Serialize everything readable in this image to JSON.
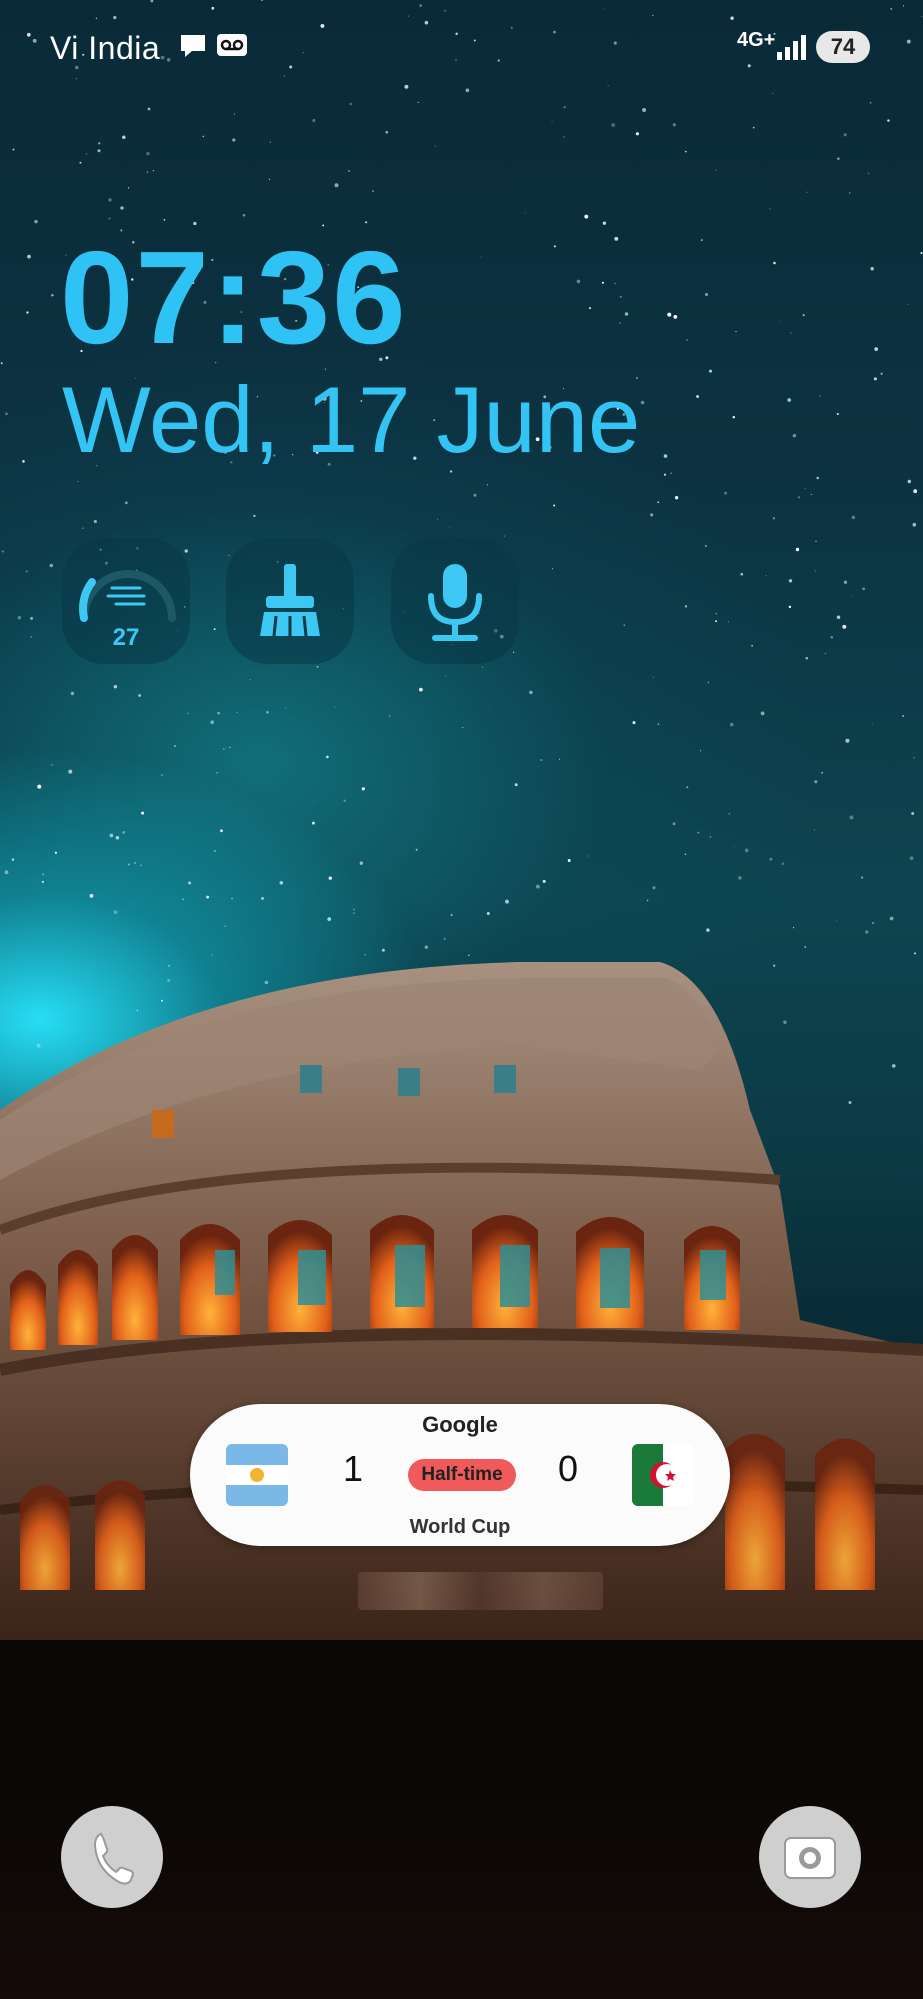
{
  "status_bar": {
    "carrier": "Vi India",
    "network": "4G+",
    "battery": "74"
  },
  "clock": {
    "time": "07:36",
    "date": "Wed, 17 June"
  },
  "widgets": {
    "weather_temp": "27"
  },
  "score_card": {
    "source": "Google",
    "home_score": "1",
    "away_score": "0",
    "status": "Half-time",
    "competition": "World Cup"
  },
  "icons": {
    "carrier_extra": [
      "chat-bubble-icon",
      "voicemail-icon"
    ],
    "network": [
      "4g-plus-icon",
      "signal-icon"
    ],
    "widgets": [
      "weather-gauge-icon",
      "broom-clean-icon",
      "microphone-icon"
    ],
    "bottom": [
      "phone-icon",
      "camera-icon"
    ]
  },
  "colors": {
    "accent": "#2fc3f5",
    "status_pill": "#f05a5a"
  }
}
